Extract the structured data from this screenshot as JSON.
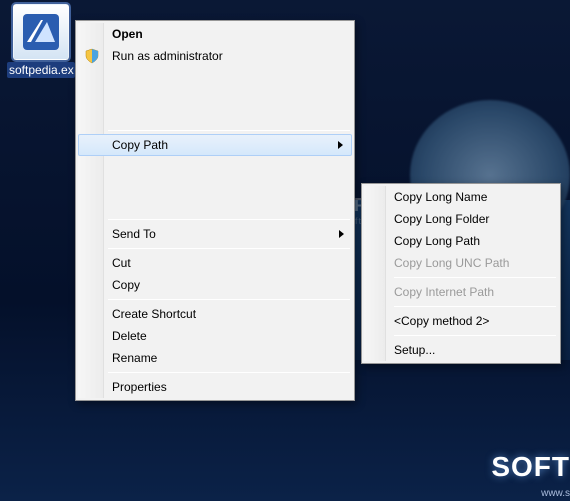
{
  "desktop_icon": {
    "label": "softpedia.ex"
  },
  "context_menu": {
    "open": "Open",
    "run_admin": "Run as administrator",
    "copy_path": "Copy Path",
    "send_to": "Send To",
    "cut": "Cut",
    "copy": "Copy",
    "create_shortcut": "Create Shortcut",
    "delete": "Delete",
    "rename": "Rename",
    "properties": "Properties"
  },
  "submenu": {
    "copy_long_name": "Copy Long Name",
    "copy_long_folder": "Copy Long Folder",
    "copy_long_path": "Copy Long Path",
    "copy_long_unc": "Copy Long UNC Path",
    "copy_internet_path": "Copy Internet Path",
    "copy_method2": "<Copy method 2>",
    "setup": "Setup..."
  },
  "watermark": {
    "text": "SOFTPEDIA",
    "sub": "www.softpedia.com"
  },
  "bg": {
    "logo": "SOFT",
    "www": "www.s"
  }
}
